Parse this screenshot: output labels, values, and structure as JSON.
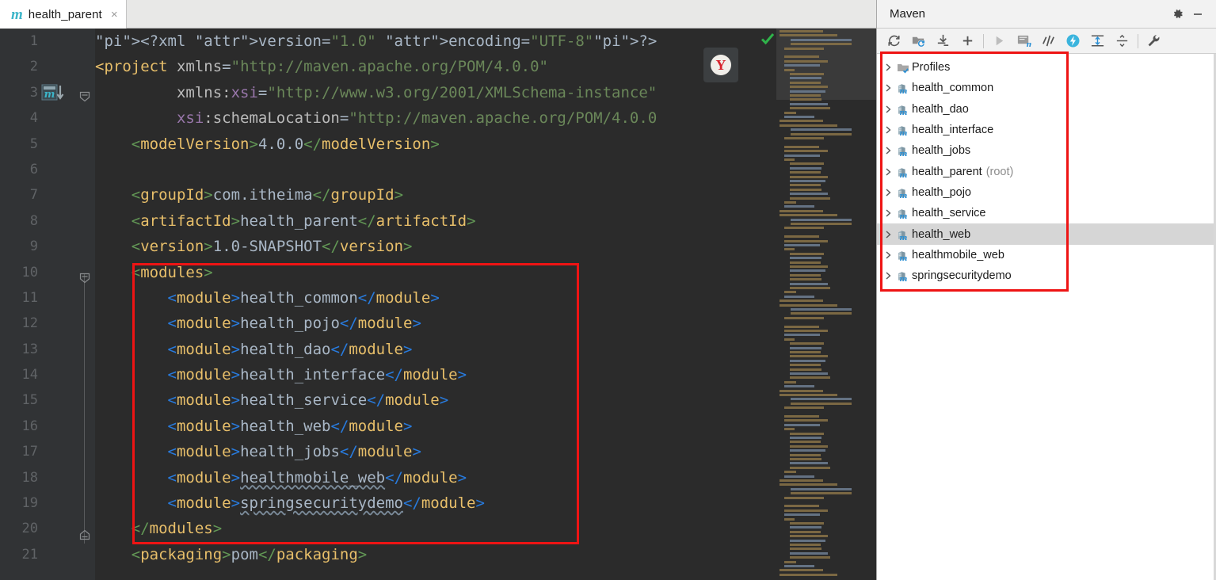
{
  "editor": {
    "tab": {
      "label": "health_parent",
      "icon": "maven-m-icon",
      "close": "×"
    },
    "gutter": {
      "line_numbers": [
        "1",
        "2",
        "3",
        "4",
        "5",
        "6",
        "7",
        "8",
        "9",
        "10",
        "11",
        "12",
        "13",
        "14",
        "15",
        "16",
        "17",
        "18",
        "19",
        "20",
        "21"
      ]
    },
    "floating_badge": {
      "name": "yandex-icon",
      "glyph": "Y"
    },
    "inspection_status": "ok-check",
    "code_lines": [
      {
        "n": 1,
        "text": "<?xml version=\"1.0\" encoding=\"UTF-8\"?>"
      },
      {
        "n": 2,
        "text": "<project xmlns=\"http://maven.apache.org/POM/4.0.0\""
      },
      {
        "n": 3,
        "text": "         xmlns:xsi=\"http://www.w3.org/2001/XMLSchema-instance\""
      },
      {
        "n": 4,
        "text": "         xsi:schemaLocation=\"http://maven.apache.org/POM/4.0.0"
      },
      {
        "n": 5,
        "text": "    <modelVersion>4.0.0</modelVersion>"
      },
      {
        "n": 6,
        "text": ""
      },
      {
        "n": 7,
        "text": "    <groupId>com.itheima</groupId>"
      },
      {
        "n": 8,
        "text": "    <artifactId>health_parent</artifactId>"
      },
      {
        "n": 9,
        "text": "    <version>1.0-SNAPSHOT</version>"
      },
      {
        "n": 10,
        "text": "    <modules>"
      },
      {
        "n": 11,
        "text": "        <module>health_common</module>"
      },
      {
        "n": 12,
        "text": "        <module>health_pojo</module>"
      },
      {
        "n": 13,
        "text": "        <module>health_dao</module>"
      },
      {
        "n": 14,
        "text": "        <module>health_interface</module>"
      },
      {
        "n": 15,
        "text": "        <module>health_service</module>"
      },
      {
        "n": 16,
        "text": "        <module>health_web</module>"
      },
      {
        "n": 17,
        "text": "        <module>health_jobs</module>"
      },
      {
        "n": 18,
        "text": "        <module>healthmobile_web</module>"
      },
      {
        "n": 19,
        "text": "        <module>springsecuritydemo</module>"
      },
      {
        "n": 20,
        "text": "    </modules>"
      },
      {
        "n": 21,
        "text": "    <packaging>pom</packaging>"
      }
    ],
    "module_values": [
      "health_common",
      "health_pojo",
      "health_dao",
      "health_interface",
      "health_service",
      "health_web",
      "health_jobs",
      "healthmobile_web",
      "springsecuritydemo"
    ],
    "xml_header": {
      "version_attr": "version",
      "version_value": "\"1.0\"",
      "encoding_attr": "encoding",
      "encoding_value": "\"UTF-8\""
    },
    "project_values": {
      "modelVersion": "4.0.0",
      "groupId": "com.itheima",
      "artifactId": "health_parent",
      "version": "1.0-SNAPSHOT",
      "packaging": "pom"
    },
    "highlight_box_color": "#ee1414"
  },
  "maven": {
    "title": "Maven",
    "header_buttons": [
      {
        "name": "settings-gear-icon",
        "label": "⚙"
      },
      {
        "name": "minimize-icon",
        "label": "—"
      }
    ],
    "toolbar": [
      {
        "name": "reload-all-projects-icon",
        "label": "refresh"
      },
      {
        "name": "generate-sources-icon",
        "label": "generate-sources"
      },
      {
        "name": "download-sources-icon",
        "label": "download"
      },
      {
        "name": "add-maven-project-icon",
        "label": "add"
      },
      {
        "name": "run-icon",
        "label": "run",
        "disabled": true
      },
      {
        "name": "execute-maven-goal-icon",
        "label": "execute-goal"
      },
      {
        "name": "toggle-skip-tests-icon",
        "label": "skip-tests"
      },
      {
        "name": "toggle-offline-mode-icon",
        "label": "offline",
        "active": true
      },
      {
        "name": "expand-all-icon",
        "label": "expand-all"
      },
      {
        "name": "collapse-all-icon",
        "label": "collapse-all"
      },
      {
        "name": "maven-settings-wrench-icon",
        "label": "settings"
      }
    ],
    "tree": [
      {
        "label": "Profiles",
        "icon": "profiles-folder-icon",
        "suffix": "",
        "selected": false
      },
      {
        "label": "health_common",
        "icon": "maven-module-icon",
        "suffix": "",
        "selected": false
      },
      {
        "label": "health_dao",
        "icon": "maven-module-icon",
        "suffix": "",
        "selected": false
      },
      {
        "label": "health_interface",
        "icon": "maven-module-icon",
        "suffix": "",
        "selected": false
      },
      {
        "label": "health_jobs",
        "icon": "maven-module-icon",
        "suffix": "",
        "selected": false
      },
      {
        "label": "health_parent",
        "icon": "maven-module-icon",
        "suffix": "(root)",
        "selected": false
      },
      {
        "label": "health_pojo",
        "icon": "maven-module-icon",
        "suffix": "",
        "selected": false
      },
      {
        "label": "health_service",
        "icon": "maven-module-icon",
        "suffix": "",
        "selected": false
      },
      {
        "label": "health_web",
        "icon": "maven-module-icon",
        "suffix": "",
        "selected": true
      },
      {
        "label": "healthmobile_web",
        "icon": "maven-module-icon",
        "suffix": "",
        "selected": false
      },
      {
        "label": "springsecuritydemo",
        "icon": "maven-module-icon",
        "suffix": "",
        "selected": false
      }
    ],
    "highlight_box_color": "#ee1414"
  },
  "colors": {
    "editor_bg": "#2b2b2b",
    "gutter_bg": "#313335",
    "tag_name": "#e8bf6a",
    "bracket_green": "#629755",
    "bracket_blue": "#287bde",
    "string_value": "#6a8759",
    "text": "#a9b7c6",
    "ns_prefix": "#9876aa",
    "accent_red": "#ee1414",
    "panel_bg": "#ffffff",
    "selection": "#d6d6d6"
  }
}
